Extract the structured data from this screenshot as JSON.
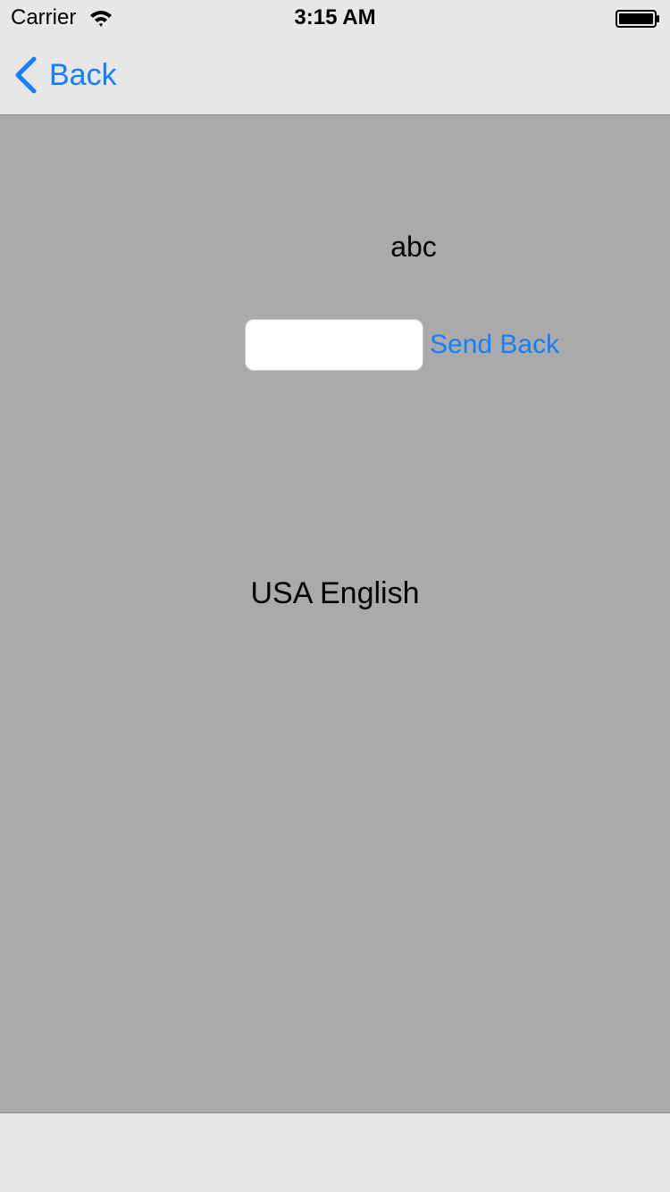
{
  "status_bar": {
    "carrier": "Carrier",
    "time": "3:15 AM",
    "icons": [
      "wifi-icon",
      "battery-icon"
    ]
  },
  "nav_bar": {
    "back_label": "Back",
    "back_icon": "chevron-left-icon"
  },
  "content": {
    "label_top": "abc",
    "text_field": {
      "value": "",
      "placeholder": ""
    },
    "send_back_label": "Send Back",
    "language_label": "USA English"
  },
  "colors": {
    "accent": "#147efb",
    "background": "#aaaaaa",
    "bar_background": "#e7e7e7"
  }
}
